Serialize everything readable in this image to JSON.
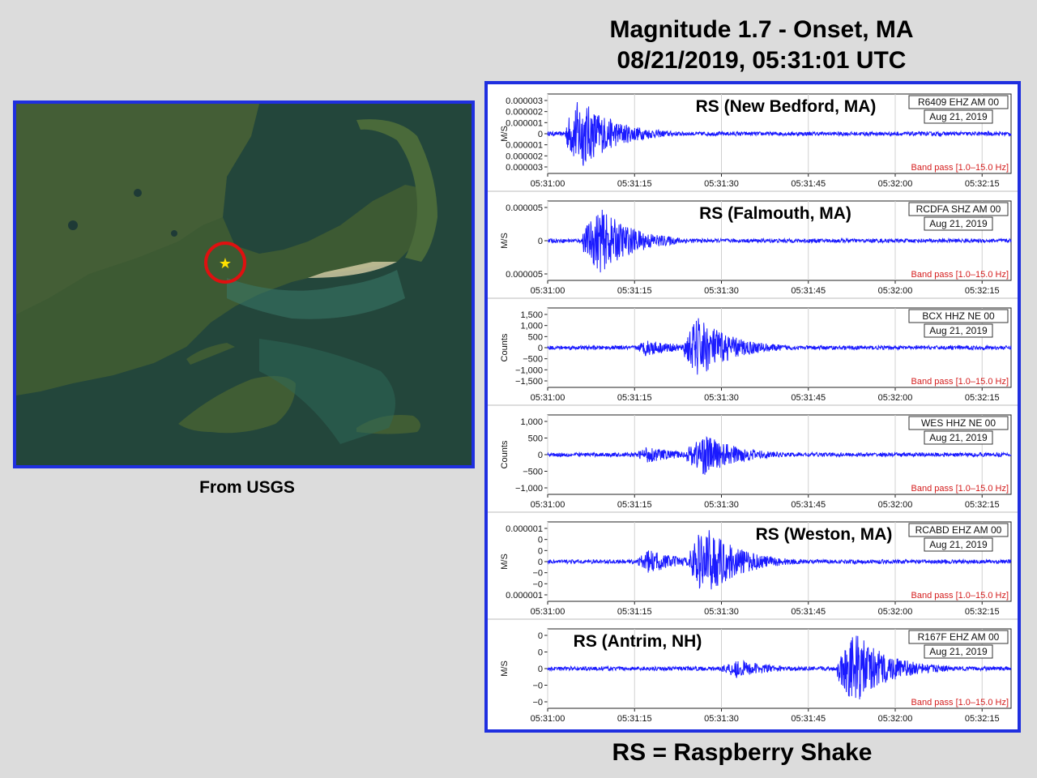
{
  "header": {
    "line1": "Magnitude 1.7 - Onset, MA",
    "line2": "08/21/2019, 05:31:01 UTC"
  },
  "map": {
    "caption": "From USGS",
    "marker_icon": "epicenter-star-icon",
    "circle_color": "#e01010",
    "star_color": "#ffe100"
  },
  "footer": "RS = Raspberry Shake",
  "colors": {
    "frame": "#1f2fe0",
    "trace": "#1a1aff",
    "bandpass": "#d41c1c"
  },
  "chart_data": [
    {
      "type": "line",
      "station": "R6409 EHZ AM 00",
      "date": "Aug 21, 2019",
      "label": "RS (New Bedford, MA)",
      "filter": "Band pass [1.0–15.0 Hz]",
      "ylabel": "M/S",
      "ytick_labels": [
        "0.000003",
        "0.000002",
        "0.000001",
        "0",
        "0.000001",
        "0.000002",
        "0.000003"
      ],
      "xtick_labels": [
        "05:31:00",
        "05:31:15",
        "05:31:30",
        "05:31:45",
        "05:32:00",
        "05:32:15"
      ],
      "x_range_s": [
        0,
        80
      ],
      "bursts": [
        {
          "onset_s": 3.0,
          "peak_s": 5.5,
          "amp": 0.95
        }
      ]
    },
    {
      "type": "line",
      "station": "RCDFA SHZ AM 00",
      "date": "Aug 21, 2019",
      "label": "RS (Falmouth, MA)",
      "filter": "Band pass [1.0–15.0 Hz]",
      "ylabel": "M/S",
      "ytick_labels": [
        "0.000005",
        "0",
        "0.000005"
      ],
      "xtick_labels": [
        "05:31:00",
        "05:31:15",
        "05:31:30",
        "05:31:45",
        "05:32:00",
        "05:32:15"
      ],
      "x_range_s": [
        0,
        80
      ],
      "bursts": [
        {
          "onset_s": 6.0,
          "peak_s": 9.0,
          "amp": 0.85
        }
      ]
    },
    {
      "type": "line",
      "station": "BCX HHZ NE 00",
      "date": "Aug 21, 2019",
      "label": "",
      "filter": "Band pass [1.0–15.0 Hz]",
      "ylabel": "Counts",
      "ytick_labels": [
        "1,500",
        "1,000",
        "500",
        "0",
        "−500",
        "−1,000",
        "−1,500"
      ],
      "xtick_labels": [
        "05:31:00",
        "05:31:15",
        "05:31:30",
        "05:31:45",
        "05:32:00",
        "05:32:15"
      ],
      "x_range_s": [
        0,
        80
      ],
      "bursts": [
        {
          "onset_s": 15.5,
          "peak_s": 17.0,
          "amp": 0.22
        },
        {
          "onset_s": 23.5,
          "peak_s": 26.0,
          "amp": 0.8
        }
      ]
    },
    {
      "type": "line",
      "station": "WES HHZ NE 00",
      "date": "Aug 21, 2019",
      "label": "",
      "filter": "Band pass [1.0–15.0 Hz]",
      "ylabel": "Counts",
      "ytick_labels": [
        "1,000",
        "500",
        "0",
        "−500",
        "−1,000"
      ],
      "xtick_labels": [
        "05:31:00",
        "05:31:15",
        "05:31:30",
        "05:31:45",
        "05:32:00",
        "05:32:15"
      ],
      "x_range_s": [
        0,
        80
      ],
      "bursts": [
        {
          "onset_s": 15.5,
          "peak_s": 17.0,
          "amp": 0.22
        },
        {
          "onset_s": 24.0,
          "peak_s": 27.0,
          "amp": 0.55
        }
      ]
    },
    {
      "type": "line",
      "station": "RCABD EHZ AM 00",
      "date": "Aug 21, 2019",
      "label": "RS (Weston, MA)",
      "filter": "Band pass [1.0–15.0 Hz]",
      "ylabel": "M/S",
      "ytick_labels": [
        "0.000001",
        "0",
        "0",
        "0",
        "−0",
        "−0",
        "0.000001"
      ],
      "xtick_labels": [
        "05:31:00",
        "05:31:15",
        "05:31:30",
        "05:31:45",
        "05:32:00",
        "05:32:15"
      ],
      "x_range_s": [
        0,
        80
      ],
      "bursts": [
        {
          "onset_s": 15.5,
          "peak_s": 17.5,
          "amp": 0.3
        },
        {
          "onset_s": 24.5,
          "peak_s": 27.0,
          "amp": 0.95
        }
      ]
    },
    {
      "type": "line",
      "station": "R167F EHZ AM 00",
      "date": "Aug 21, 2019",
      "label": "RS (Antrim, NH)",
      "filter": "Band pass [1.0–15.0 Hz]",
      "ylabel": "M/S",
      "ytick_labels": [
        "0",
        "0",
        "0",
        "−0",
        "−0"
      ],
      "xtick_labels": [
        "05:31:00",
        "05:31:15",
        "05:31:30",
        "05:31:45",
        "05:32:00",
        "05:32:15"
      ],
      "x_range_s": [
        0,
        80
      ],
      "bursts": [
        {
          "onset_s": 30.0,
          "peak_s": 32.5,
          "amp": 0.25
        },
        {
          "onset_s": 50.0,
          "peak_s": 53.0,
          "amp": 0.95
        }
      ]
    }
  ]
}
